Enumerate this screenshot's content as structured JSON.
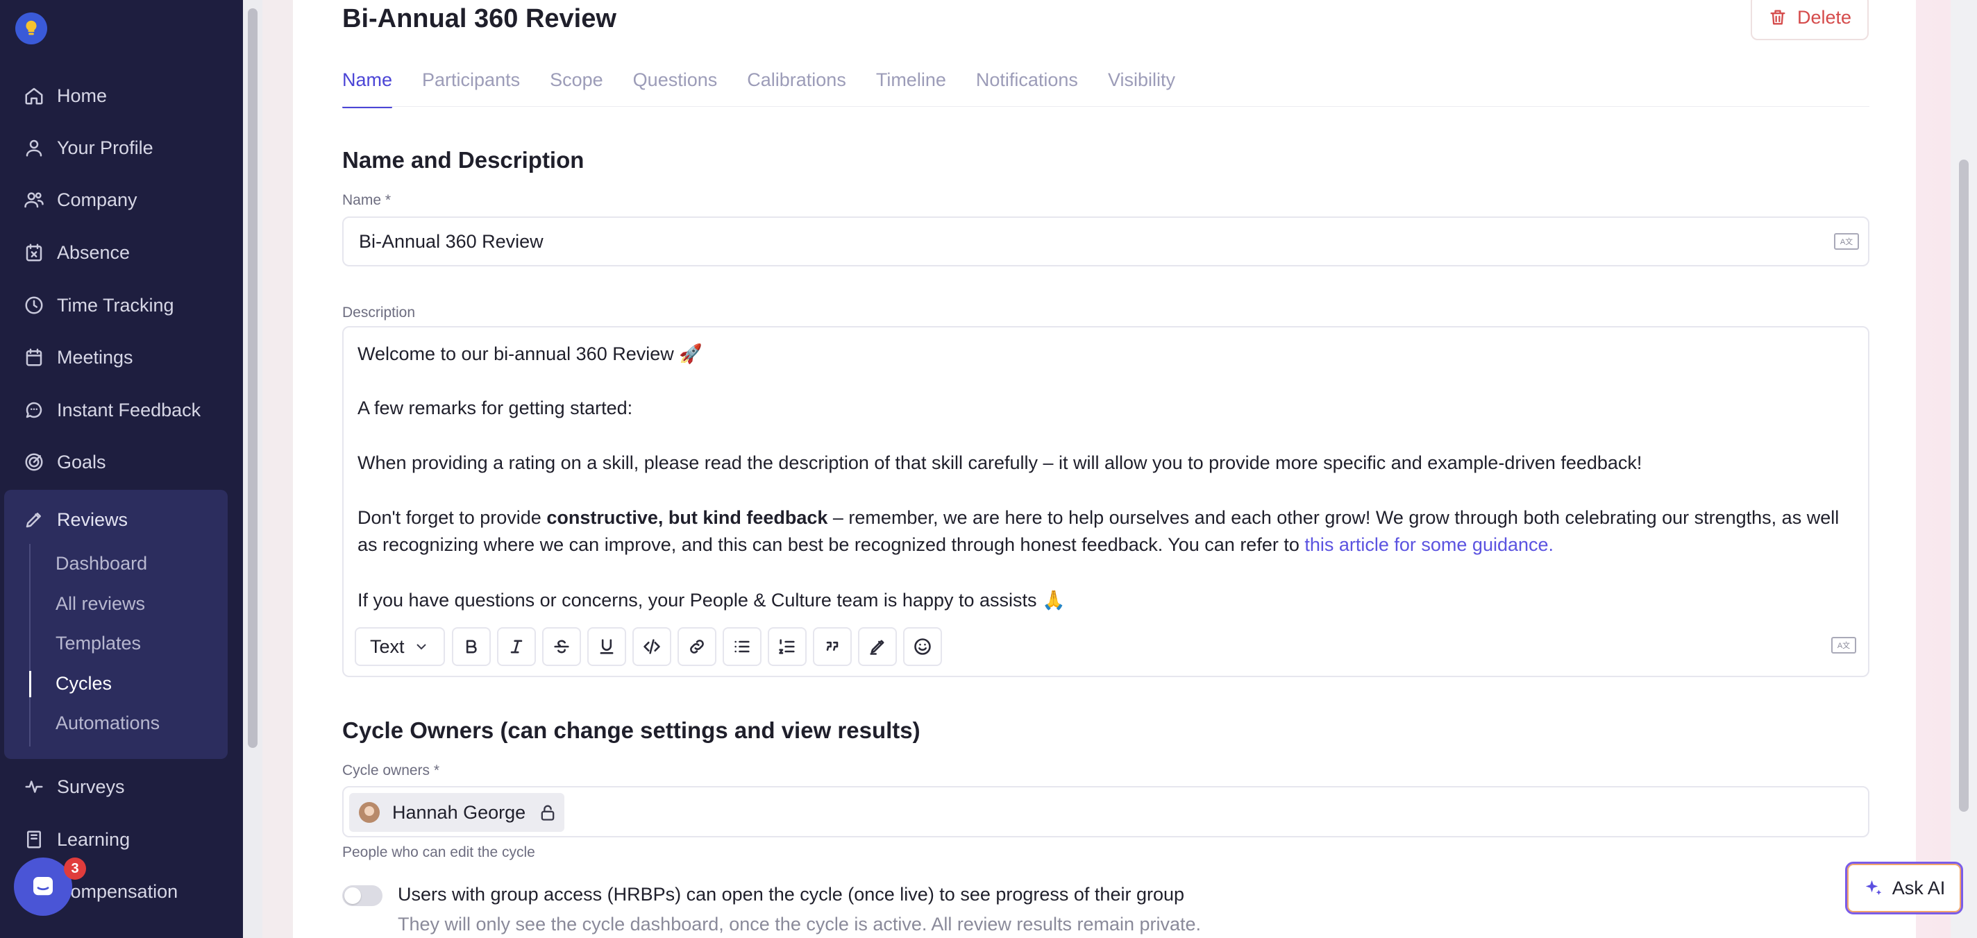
{
  "sidebar": {
    "items_top": [
      {
        "label": "Home",
        "icon": "home-icon"
      },
      {
        "label": "Your Profile",
        "icon": "user-icon"
      },
      {
        "label": "Company",
        "icon": "users-icon"
      },
      {
        "label": "Absence",
        "icon": "calendar-x-icon"
      },
      {
        "label": "Time Tracking",
        "icon": "clock-icon"
      },
      {
        "label": "Meetings",
        "icon": "calendar-icon"
      },
      {
        "label": "Instant Feedback",
        "icon": "chat-bubble-icon"
      },
      {
        "label": "Goals",
        "icon": "target-icon"
      }
    ],
    "reviews": {
      "label": "Reviews",
      "sub_items": [
        "Dashboard",
        "All reviews",
        "Templates",
        "Cycles",
        "Automations"
      ],
      "active": "Cycles"
    },
    "items_bottom": [
      {
        "label": "Surveys",
        "icon": "pulse-icon"
      },
      {
        "label": "Learning",
        "icon": "book-icon"
      },
      {
        "label": "Compensation",
        "icon": "money-icon"
      }
    ],
    "chat_badge": "3"
  },
  "page": {
    "title": "Bi-Annual 360 Review",
    "delete_label": "Delete",
    "tabs": [
      "Name",
      "Participants",
      "Scope",
      "Questions",
      "Calibrations",
      "Timeline",
      "Notifications",
      "Visibility"
    ],
    "active_tab": "Name"
  },
  "name_section": {
    "title": "Name and Description",
    "name_label": "Name *",
    "name_value": "Bi-Annual 360 Review",
    "description_label": "Description",
    "description": {
      "line1": "Welcome to our bi-annual 360 Review 🚀",
      "line2": "A few remarks for getting started:",
      "line3": "When providing a rating on a skill, please read the description of that skill carefully – it will allow you to provide more specific and example-driven feedback!",
      "line4_pre": "Don't forget to provide ",
      "line4_bold": "constructive, but kind feedback",
      "line4_post": " – remember, we are here to help ourselves and each other grow! We grow through both celebrating our strengths, as well",
      "line5_pre": "as recognizing where we can improve, and this can best be recognized through honest feedback. You can refer to ",
      "line5_link": "this article for some guidance.",
      "line6": "If you have questions or concerns, your People & Culture team is happy to assists 🙏"
    },
    "toolbar": {
      "text_style": "Text",
      "buttons": [
        "bold-icon",
        "italic-icon",
        "strikethrough-icon",
        "underline-icon",
        "code-icon",
        "link-icon",
        "bullet-list-icon",
        "numbered-list-icon",
        "quote-icon",
        "highlighter-icon",
        "emoji-icon"
      ]
    }
  },
  "owners_section": {
    "title": "Cycle Owners (can change settings and view results)",
    "label": "Cycle owners *",
    "owner_name": "Hannah George",
    "help": "People who can edit the cycle"
  },
  "hrbp_toggle": {
    "enabled": false,
    "label": "Users with group access (HRBPs) can open the cycle (once live) to see progress of their group",
    "help": "They will only see the cycle dashboard, once the cycle is active. All review results remain private."
  },
  "ask_ai_label": "Ask AI",
  "colors": {
    "sidebar_bg": "#1e1e3f",
    "accent": "#4b45d6",
    "danger": "#d54b4b"
  }
}
